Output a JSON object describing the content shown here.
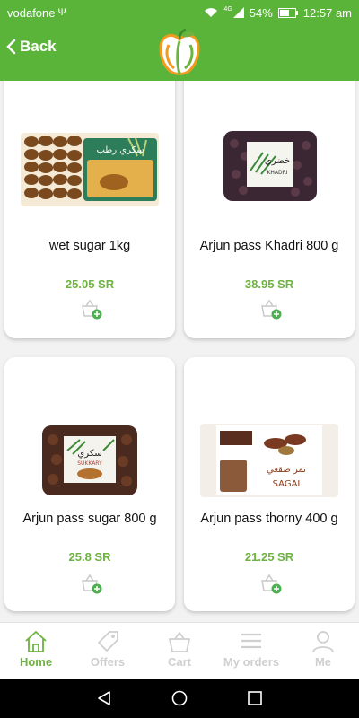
{
  "status_bar": {
    "carrier": "vodafone",
    "battery": "54%",
    "time": "12:57 am",
    "signal_type": "4G"
  },
  "header": {
    "back_label": "Back",
    "logo_icon": "apple-logo-icon",
    "colors": {
      "primary": "#5bb43a"
    }
  },
  "products": [
    {
      "name": "wet sugar 1kg",
      "price": "25.05 SR",
      "image_text": "سكري رطب",
      "image_subtext": ""
    },
    {
      "name": "Arjun pass Khadri 800 g",
      "price": "38.95 SR",
      "image_text": "خضري",
      "image_subtext": "KHADRI"
    },
    {
      "name": "Arjun pass sugar 800 g",
      "price": "25.8 SR",
      "image_text": "سكري",
      "image_subtext": "SUKKARY"
    },
    {
      "name": "Arjun pass thorny 400 g",
      "price": "21.25 SR",
      "image_text": "تمر صقعي",
      "image_subtext": "SAGAI"
    }
  ],
  "bottom_nav": [
    {
      "label": "Home",
      "icon": "home-icon",
      "active": true
    },
    {
      "label": "Offers",
      "icon": "tag-icon",
      "active": false
    },
    {
      "label": "Cart",
      "icon": "basket-icon",
      "active": false
    },
    {
      "label": "My orders",
      "icon": "list-icon",
      "active": false
    },
    {
      "label": "Me",
      "icon": "user-icon",
      "active": false
    }
  ],
  "colors": {
    "accent": "#6db33f",
    "inactive": "#cfcfcf"
  }
}
